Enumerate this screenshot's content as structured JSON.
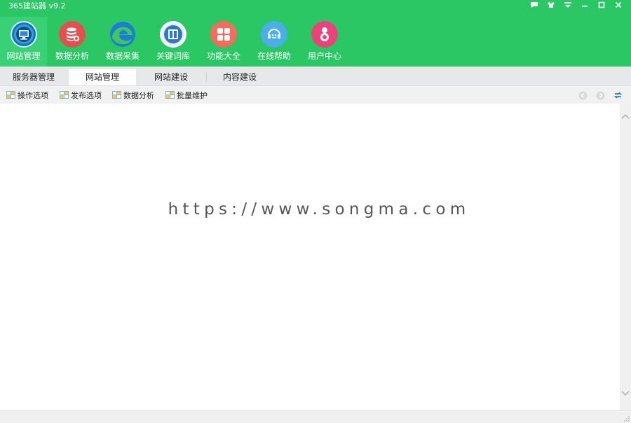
{
  "app": {
    "title": "365建站器 v9.2"
  },
  "window_controls": [
    {
      "name": "feedback-icon"
    },
    {
      "name": "skin-icon"
    },
    {
      "name": "menu-icon"
    },
    {
      "name": "minimize-icon"
    },
    {
      "name": "maximize-icon"
    },
    {
      "name": "close-icon"
    }
  ],
  "main_nav": [
    {
      "label": "网站管理",
      "icon": "monitor-icon",
      "color": "#1f6fb5",
      "active": true
    },
    {
      "label": "数据分析",
      "icon": "database-icon",
      "color": "#e4504f"
    },
    {
      "label": "数据采集",
      "icon": "edge-icon",
      "color": "#2b8fd6"
    },
    {
      "label": "关键词库",
      "icon": "book-icon",
      "color": "#2c78c4"
    },
    {
      "label": "功能大全",
      "icon": "apps-icon",
      "color": "#f26d5b"
    },
    {
      "label": "在线帮助",
      "icon": "headset-icon",
      "color": "#4aaee8"
    },
    {
      "label": "用户中心",
      "icon": "user-icon",
      "color": "#e8437a"
    }
  ],
  "tabs": [
    {
      "label": "服务器管理"
    },
    {
      "label": "网站管理",
      "active": true
    },
    {
      "label": "网站建设"
    },
    {
      "label": "内容建设"
    }
  ],
  "toolbar": [
    {
      "label": "操作选项"
    },
    {
      "label": "发布选项"
    },
    {
      "label": "数据分析"
    },
    {
      "label": "批量维护"
    }
  ],
  "content": {
    "watermark": "https://www.songma.com"
  }
}
